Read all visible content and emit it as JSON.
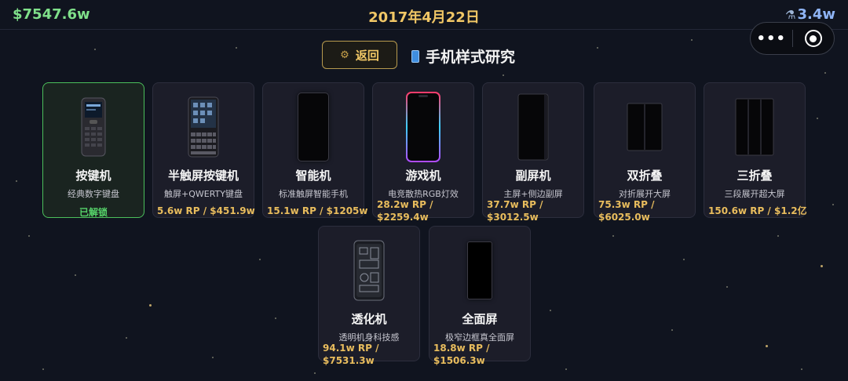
{
  "header": {
    "money": "$7547.6w",
    "date": "2017年4月22日",
    "research": "3.4w",
    "research_icon": "microscope-icon"
  },
  "capsule": {
    "menu_label": "•••",
    "menu_icon": "more-dots-icon",
    "close_icon": "target-icon"
  },
  "nav": {
    "back_label": "返回",
    "back_icon": "gear-icon",
    "title": "手机样式研究",
    "title_icon": "phone-icon"
  },
  "phones": [
    {
      "name": "按键机",
      "desc": "经典数字键盘",
      "status": "已解锁",
      "unlocked": true,
      "icon": "keypad-phone-icon"
    },
    {
      "name": "半触屏按键机",
      "desc": "触屏+QWERTY键盘",
      "cost": "5.6w RP / $451.9w",
      "icon": "qwerty-phone-icon"
    },
    {
      "name": "智能机",
      "desc": "标准触屏智能手机",
      "cost": "15.1w RP / $1205w",
      "icon": "smartphone-icon"
    },
    {
      "name": "游戏机",
      "desc": "电竞散热RGB灯效",
      "cost": "28.2w RP / $2259.4w",
      "icon": "gaming-phone-icon"
    },
    {
      "name": "副屏机",
      "desc": "主屏+侧边副屏",
      "cost": "37.7w RP / $3012.5w",
      "icon": "side-screen-phone-icon"
    },
    {
      "name": "双折叠",
      "desc": "对折展开大屏",
      "cost": "75.3w RP / $6025.0w",
      "icon": "dual-fold-phone-icon"
    },
    {
      "name": "三折叠",
      "desc": "三段展开超大屏",
      "cost": "150.6w RP / $1.2亿",
      "icon": "tri-fold-phone-icon"
    },
    {
      "name": "透化机",
      "desc": "透明机身科技感",
      "cost": "94.1w RP / $7531.3w",
      "icon": "transparent-phone-icon"
    },
    {
      "name": "全面屏",
      "desc": "极窄边框真全面屏",
      "cost": "18.8w RP / $1506.3w",
      "icon": "full-screen-phone-icon"
    }
  ]
}
